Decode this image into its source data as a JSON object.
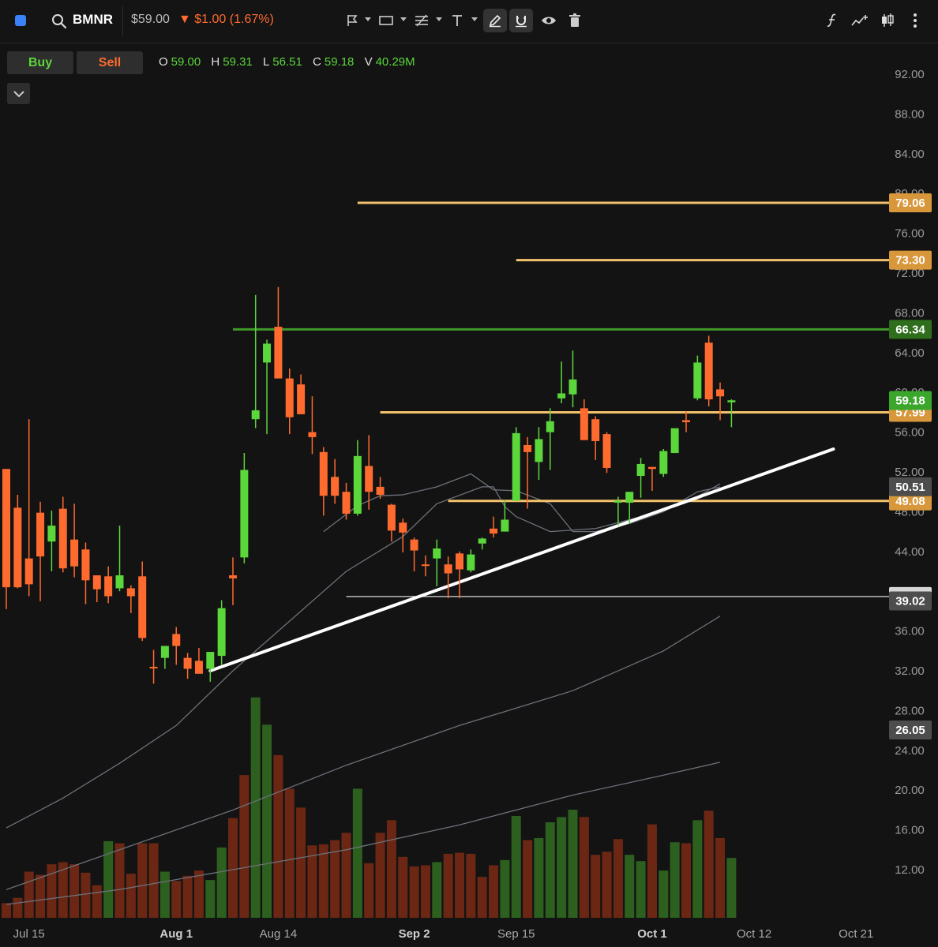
{
  "header": {
    "ticker": "BMNR",
    "price": "$59.00",
    "change": "$1.00 (1.67%)",
    "direction": "down"
  },
  "toolbar": {
    "tools": [
      "annotation-flag-icon",
      "rectangle-icon",
      "fib-lines-icon",
      "text-tool-icon",
      "pencil-icon",
      "magnet-icon",
      "eye-icon",
      "trash-icon"
    ],
    "right_tools": [
      "function-icon",
      "indicator-add-icon",
      "candle-type-icon",
      "more-options-icon"
    ]
  },
  "trade": {
    "buy_label": "Buy",
    "sell_label": "Sell"
  },
  "ohlcv": {
    "o_label": "O",
    "o": "59.00",
    "h_label": "H",
    "h": "59.31",
    "l_label": "L",
    "l": "56.51",
    "c_label": "C",
    "c": "59.18",
    "v_label": "V",
    "v": "40.29M"
  },
  "colors": {
    "up": "#5bd63b",
    "down": "#ff6a2f",
    "gold": "#f3c26c",
    "green_line": "#3f9a2a",
    "bg": "#131313"
  },
  "chart_data": {
    "type": "candlestick",
    "y_axis": {
      "min": 8,
      "max": 94,
      "ticks": [
        "92.00",
        "88.00",
        "84.00",
        "80.00",
        "76.00",
        "72.00",
        "68.00",
        "64.00",
        "60.00",
        "56.00",
        "52.00",
        "48.00",
        "44.00",
        "40.00",
        "36.00",
        "32.00",
        "28.00",
        "24.00",
        "20.00",
        "16.00",
        "12.00"
      ]
    },
    "x_axis_labels": [
      {
        "label": "Jul 15",
        "index": 2,
        "bold": false
      },
      {
        "label": "Aug 1",
        "index": 15,
        "bold": true
      },
      {
        "label": "Aug 14",
        "index": 24,
        "bold": false
      },
      {
        "label": "Sep 2",
        "index": 36,
        "bold": true
      },
      {
        "label": "Sep 15",
        "index": 45,
        "bold": false
      },
      {
        "label": "Oct 1",
        "index": 57,
        "bold": true
      },
      {
        "label": "Oct 12",
        "index": 66,
        "bold": false
      },
      {
        "label": "Oct 21",
        "index": 75,
        "bold": false
      }
    ],
    "candles": [
      {
        "o": 52.3,
        "h": 52.3,
        "l": 38.2,
        "c": 40.4
      },
      {
        "o": 48.4,
        "h": 49.7,
        "l": 40.3,
        "c": 40.4
      },
      {
        "o": 43.3,
        "h": 57.3,
        "l": 39.5,
        "c": 40.7
      },
      {
        "o": 47.9,
        "h": 49.0,
        "l": 39.0,
        "c": 43.5
      },
      {
        "o": 45.0,
        "h": 48.1,
        "l": 42.0,
        "c": 46.6
      },
      {
        "o": 48.3,
        "h": 49.5,
        "l": 41.9,
        "c": 42.3
      },
      {
        "o": 45.2,
        "h": 48.8,
        "l": 41.4,
        "c": 42.5
      },
      {
        "o": 44.2,
        "h": 44.9,
        "l": 38.7,
        "c": 41.1
      },
      {
        "o": 41.6,
        "h": 41.6,
        "l": 38.9,
        "c": 40.2
      },
      {
        "o": 41.5,
        "h": 42.5,
        "l": 38.8,
        "c": 39.5
      },
      {
        "o": 40.3,
        "h": 46.6,
        "l": 40.0,
        "c": 41.6
      },
      {
        "o": 40.3,
        "h": 40.6,
        "l": 37.8,
        "c": 39.5
      },
      {
        "o": 41.5,
        "h": 43.0,
        "l": 35.0,
        "c": 35.3
      },
      {
        "o": 32.4,
        "h": 34.1,
        "l": 30.7,
        "c": 32.3
      },
      {
        "o": 33.3,
        "h": 34.5,
        "l": 32.2,
        "c": 34.5
      },
      {
        "o": 35.7,
        "h": 36.4,
        "l": 32.6,
        "c": 34.5
      },
      {
        "o": 33.3,
        "h": 33.8,
        "l": 31.2,
        "c": 32.2
      },
      {
        "o": 33.0,
        "h": 34.3,
        "l": 31.7,
        "c": 31.7
      },
      {
        "o": 32.2,
        "h": 33.6,
        "l": 30.9,
        "c": 33.9
      },
      {
        "o": 33.5,
        "h": 39.1,
        "l": 32.6,
        "c": 38.3
      },
      {
        "o": 41.6,
        "h": 43.4,
        "l": 38.6,
        "c": 41.3
      },
      {
        "o": 43.4,
        "h": 53.9,
        "l": 42.8,
        "c": 52.2
      },
      {
        "o": 57.3,
        "h": 69.8,
        "l": 56.4,
        "c": 58.2
      },
      {
        "o": 63.0,
        "h": 65.3,
        "l": 55.8,
        "c": 64.9
      },
      {
        "o": 66.6,
        "h": 70.6,
        "l": 62.6,
        "c": 61.4
      },
      {
        "o": 61.4,
        "h": 62.4,
        "l": 55.8,
        "c": 57.5
      },
      {
        "o": 60.8,
        "h": 61.8,
        "l": 57.8,
        "c": 57.8
      },
      {
        "o": 56.0,
        "h": 59.6,
        "l": 53.8,
        "c": 55.5
      },
      {
        "o": 54.0,
        "h": 54.5,
        "l": 47.6,
        "c": 49.6
      },
      {
        "o": 51.5,
        "h": 53.3,
        "l": 48.8,
        "c": 49.6
      },
      {
        "o": 50.0,
        "h": 50.9,
        "l": 47.2,
        "c": 47.8
      },
      {
        "o": 47.8,
        "h": 55.2,
        "l": 47.6,
        "c": 53.6
      },
      {
        "o": 52.6,
        "h": 55.7,
        "l": 48.2,
        "c": 50.0
      },
      {
        "o": 50.5,
        "h": 51.5,
        "l": 49.3,
        "c": 49.7
      },
      {
        "o": 48.7,
        "h": 48.8,
        "l": 45.0,
        "c": 46.1
      },
      {
        "o": 46.9,
        "h": 47.3,
        "l": 43.9,
        "c": 45.9
      },
      {
        "o": 45.2,
        "h": 45.4,
        "l": 42.0,
        "c": 44.1
      },
      {
        "o": 42.7,
        "h": 43.6,
        "l": 41.5,
        "c": 42.6
      },
      {
        "o": 43.3,
        "h": 45.2,
        "l": 40.5,
        "c": 44.3
      },
      {
        "o": 42.7,
        "h": 43.5,
        "l": 39.3,
        "c": 41.8
      },
      {
        "o": 43.8,
        "h": 44.0,
        "l": 39.3,
        "c": 42.2
      },
      {
        "o": 42.1,
        "h": 44.2,
        "l": 41.9,
        "c": 43.7
      },
      {
        "o": 44.8,
        "h": 45.4,
        "l": 44.2,
        "c": 45.3
      },
      {
        "o": 46.3,
        "h": 47.5,
        "l": 45.4,
        "c": 45.8
      },
      {
        "o": 46.0,
        "h": 49.2,
        "l": 46.0,
        "c": 47.2
      },
      {
        "o": 49.1,
        "h": 56.5,
        "l": 49.1,
        "c": 55.9
      },
      {
        "o": 54.7,
        "h": 55.5,
        "l": 48.3,
        "c": 54.0
      },
      {
        "o": 53.0,
        "h": 56.5,
        "l": 51.2,
        "c": 55.3
      },
      {
        "o": 56.0,
        "h": 58.4,
        "l": 52.2,
        "c": 57.1
      },
      {
        "o": 59.4,
        "h": 63.1,
        "l": 58.9,
        "c": 59.9
      },
      {
        "o": 59.8,
        "h": 64.2,
        "l": 58.5,
        "c": 61.3
      },
      {
        "o": 58.4,
        "h": 59.3,
        "l": 55.2,
        "c": 55.2
      },
      {
        "o": 57.3,
        "h": 57.6,
        "l": 53.2,
        "c": 55.1
      },
      {
        "o": 55.8,
        "h": 56.0,
        "l": 51.9,
        "c": 52.4
      },
      {
        "o": 48.9,
        "h": 49.5,
        "l": 46.6,
        "c": 49.1
      },
      {
        "o": 48.9,
        "h": 49.8,
        "l": 46.8,
        "c": 50.0
      },
      {
        "o": 51.6,
        "h": 53.4,
        "l": 49.4,
        "c": 52.8
      },
      {
        "o": 52.5,
        "h": 52.5,
        "l": 50.1,
        "c": 52.3
      },
      {
        "o": 51.8,
        "h": 54.3,
        "l": 51.5,
        "c": 54.1
      },
      {
        "o": 53.9,
        "h": 56.3,
        "l": 53.9,
        "c": 56.4
      },
      {
        "o": 57.2,
        "h": 58.1,
        "l": 56.0,
        "c": 57.0
      },
      {
        "o": 59.4,
        "h": 63.7,
        "l": 59.2,
        "c": 63.0
      },
      {
        "o": 65.0,
        "h": 65.7,
        "l": 58.6,
        "c": 59.3
      },
      {
        "o": 60.3,
        "h": 61.0,
        "l": 57.2,
        "c": 59.6
      },
      {
        "o": 59.0,
        "h": 59.3,
        "l": 56.5,
        "c": 59.2
      }
    ],
    "volume": [
      {
        "v": 1.4,
        "up": false
      },
      {
        "v": 1.9,
        "up": false
      },
      {
        "v": 4.4,
        "up": false
      },
      {
        "v": 4.1,
        "up": false
      },
      {
        "v": 5.1,
        "up": false
      },
      {
        "v": 5.3,
        "up": false
      },
      {
        "v": 5.1,
        "up": false
      },
      {
        "v": 4.3,
        "up": false
      },
      {
        "v": 3.1,
        "up": false
      },
      {
        "v": 7.3,
        "up": true
      },
      {
        "v": 7.1,
        "up": false
      },
      {
        "v": 4.2,
        "up": false
      },
      {
        "v": 7.1,
        "up": false
      },
      {
        "v": 7.1,
        "up": false
      },
      {
        "v": 4.4,
        "up": true
      },
      {
        "v": 3.5,
        "up": false
      },
      {
        "v": 4.0,
        "up": false
      },
      {
        "v": 4.5,
        "up": false
      },
      {
        "v": 3.6,
        "up": true
      },
      {
        "v": 6.7,
        "up": true
      },
      {
        "v": 9.5,
        "up": false
      },
      {
        "v": 13.6,
        "up": false
      },
      {
        "v": 21.0,
        "up": true
      },
      {
        "v": 18.4,
        "up": true
      },
      {
        "v": 15.5,
        "up": false
      },
      {
        "v": 12.3,
        "up": false
      },
      {
        "v": 10.5,
        "up": false
      },
      {
        "v": 6.9,
        "up": false
      },
      {
        "v": 7.0,
        "up": false
      },
      {
        "v": 7.4,
        "up": false
      },
      {
        "v": 8.1,
        "up": false
      },
      {
        "v": 12.3,
        "up": true
      },
      {
        "v": 5.2,
        "up": false
      },
      {
        "v": 8.1,
        "up": false
      },
      {
        "v": 9.3,
        "up": false
      },
      {
        "v": 5.8,
        "up": false
      },
      {
        "v": 4.9,
        "up": false
      },
      {
        "v": 5.0,
        "up": false
      },
      {
        "v": 5.3,
        "up": true
      },
      {
        "v": 6.1,
        "up": false
      },
      {
        "v": 6.2,
        "up": false
      },
      {
        "v": 6.1,
        "up": false
      },
      {
        "v": 3.9,
        "up": false
      },
      {
        "v": 5.0,
        "up": false
      },
      {
        "v": 5.5,
        "up": true
      },
      {
        "v": 9.7,
        "up": true
      },
      {
        "v": 7.4,
        "up": false
      },
      {
        "v": 7.6,
        "up": true
      },
      {
        "v": 9.1,
        "up": true
      },
      {
        "v": 9.6,
        "up": true
      },
      {
        "v": 10.3,
        "up": true
      },
      {
        "v": 9.6,
        "up": false
      },
      {
        "v": 6.0,
        "up": false
      },
      {
        "v": 6.3,
        "up": false
      },
      {
        "v": 7.5,
        "up": false
      },
      {
        "v": 6.0,
        "up": true
      },
      {
        "v": 5.4,
        "up": true
      },
      {
        "v": 8.9,
        "up": false
      },
      {
        "v": 4.5,
        "up": true
      },
      {
        "v": 7.2,
        "up": true
      },
      {
        "v": 7.1,
        "up": false
      },
      {
        "v": 9.3,
        "up": true
      },
      {
        "v": 10.2,
        "up": false
      },
      {
        "v": 7.6,
        "up": false
      },
      {
        "v": 5.7,
        "up": true
      }
    ],
    "moving_averages": [
      {
        "points": [
          [
            28,
            46.0
          ],
          [
            31,
            48.6
          ],
          [
            33,
            49.6
          ],
          [
            35,
            49.7
          ],
          [
            38,
            50.5
          ],
          [
            41,
            51.8
          ],
          [
            43,
            50.2
          ],
          [
            45,
            50.1
          ],
          [
            48,
            48.8
          ],
          [
            50,
            46.0
          ],
          [
            52,
            46.0
          ],
          [
            55,
            46.8
          ],
          [
            58,
            48.0
          ],
          [
            61,
            50.0
          ],
          [
            63,
            50.5
          ]
        ]
      },
      {
        "points": [
          [
            0,
            16.2
          ],
          [
            5,
            19.2
          ],
          [
            10,
            22.7
          ],
          [
            15,
            26.5
          ],
          [
            20,
            32.0
          ],
          [
            25,
            37.0
          ],
          [
            30,
            42.0
          ],
          [
            35,
            45.5
          ],
          [
            38,
            48.8
          ],
          [
            42,
            50.5
          ],
          [
            43,
            50.5
          ],
          [
            44,
            48.5
          ],
          [
            45,
            47.5
          ],
          [
            48,
            46.0
          ],
          [
            52,
            46.3
          ],
          [
            56,
            47.5
          ],
          [
            60,
            48.9
          ],
          [
            63,
            50.8
          ]
        ]
      },
      {
        "points": [
          [
            0,
            10.0
          ],
          [
            10,
            14.0
          ],
          [
            20,
            18.0
          ],
          [
            30,
            22.5
          ],
          [
            40,
            26.5
          ],
          [
            50,
            30.0
          ],
          [
            58,
            34.0
          ],
          [
            63,
            37.5
          ]
        ]
      },
      {
        "points": [
          [
            0,
            8.5
          ],
          [
            10,
            10.0
          ],
          [
            20,
            12.0
          ],
          [
            30,
            14.0
          ],
          [
            40,
            16.5
          ],
          [
            50,
            19.5
          ],
          [
            58,
            21.5
          ],
          [
            63,
            22.8
          ]
        ]
      }
    ],
    "trendline": {
      "start": [
        18,
        32.0
      ],
      "end": [
        73,
        54.3
      ]
    },
    "horizontal_levels": [
      {
        "value": 79.06,
        "label": "79.06",
        "start_index": 31,
        "color": "gold"
      },
      {
        "value": 73.3,
        "label": "73.30",
        "start_index": 45,
        "color": "gold"
      },
      {
        "value": 66.34,
        "label": "66.34",
        "start_index": 20,
        "color": "green"
      },
      {
        "value": 57.99,
        "label": "57.99",
        "start_index": 33,
        "color": "gold"
      },
      {
        "value": 49.08,
        "label": "49.08",
        "start_index": 39,
        "color": "gold"
      },
      {
        "value": 39.47,
        "label": "39.47",
        "start_index": 30,
        "color": "white"
      }
    ],
    "price_labels": [
      {
        "value": 59.18,
        "label": "59.18",
        "bg": "#3aa62b",
        "fg": "#ffffff"
      },
      {
        "value": 50.51,
        "label": "50.51",
        "bg": "#4d4d4d",
        "fg": "#ffffff"
      },
      {
        "value": 39.02,
        "label": "39.02",
        "bg": "#4d4d4d",
        "fg": "#ffffff"
      },
      {
        "value": 26.05,
        "label": "26.05",
        "bg": "#4d4d4d",
        "fg": "#ffffff"
      }
    ]
  }
}
